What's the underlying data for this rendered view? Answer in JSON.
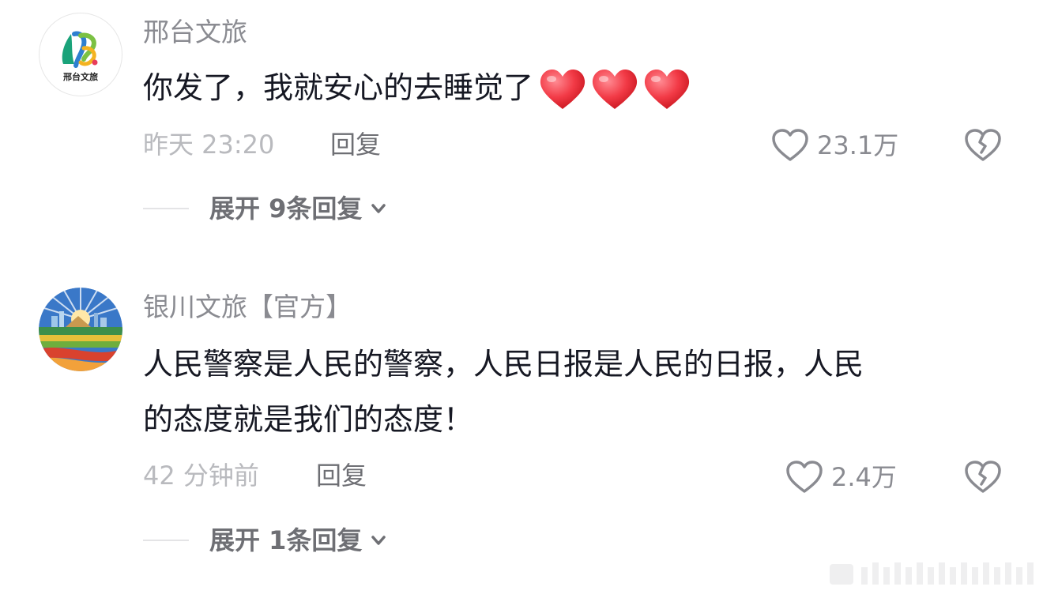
{
  "comments": [
    {
      "username": "邢台文旅",
      "avatar_logo_text": "邢台文旅",
      "text": "你发了，我就安心的去睡觉了",
      "emoji": [
        "red-heart-icon",
        "red-heart-icon",
        "red-heart-icon"
      ],
      "time": "昨天 23:20",
      "reply_label": "回复",
      "like_count": "23.1万",
      "expand_label": "展开 9条回复"
    },
    {
      "username": "银川文旅【官方】",
      "text_line1": "人民警察是人民的警察，人民日报是人民的日报，人民",
      "text_line2": "的态度就是我们的态度！",
      "time": "42 分钟前",
      "reply_label": "回复",
      "like_count": "2.4万",
      "expand_label": "展开 1条回复"
    }
  ],
  "colors": {
    "username": "#8a8b91",
    "text": "#161823",
    "meta": "#b9babe",
    "heart_red": "#f0303e"
  },
  "icons": {
    "like": "heart-outline-icon",
    "dislike": "broken-heart-outline-icon",
    "expand": "chevron-down-icon"
  }
}
